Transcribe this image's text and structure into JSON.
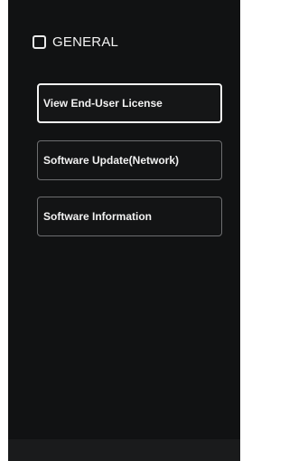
{
  "header": {
    "title": "GENERAL",
    "icon": "settings-square-icon"
  },
  "menu": {
    "items": [
      {
        "label": "View End-User License",
        "selected": true
      },
      {
        "label": "Software Update(Network)",
        "selected": false
      },
      {
        "label": "Software Information",
        "selected": false
      }
    ]
  },
  "colors": {
    "background": "#111213",
    "text": "#f2f2f2",
    "item_border": "#6d6e70",
    "selected_border": "#f5f5f5"
  }
}
